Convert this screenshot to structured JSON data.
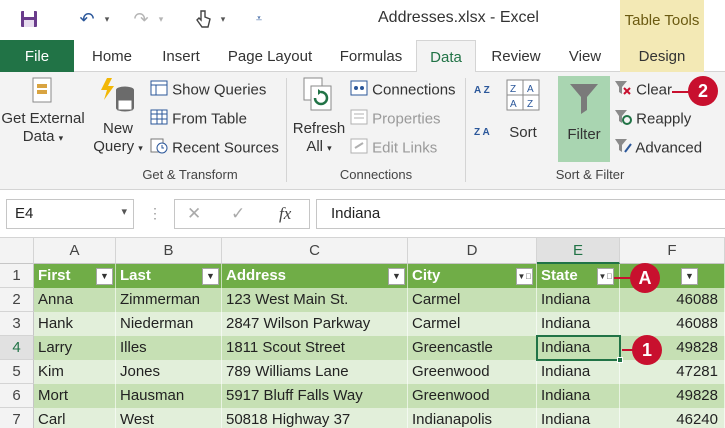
{
  "title_bar": {
    "title": "Addresses.xlsx - Excel",
    "table_tools": "Table Tools"
  },
  "tabs": [
    {
      "label": "File"
    },
    {
      "label": "Home"
    },
    {
      "label": "Insert"
    },
    {
      "label": "Page Layout"
    },
    {
      "label": "Formulas"
    },
    {
      "label": "Data"
    },
    {
      "label": "Review"
    },
    {
      "label": "View"
    },
    {
      "label": "Design"
    }
  ],
  "ribbon": {
    "get_external_1": "Get External",
    "get_external_2": "Data",
    "new_query_1": "New",
    "new_query_2": "Query",
    "show_queries": "Show Queries",
    "from_table": "From Table",
    "recent_sources": "Recent Sources",
    "group_get_transform": "Get & Transform",
    "refresh_1": "Refresh",
    "refresh_2": "All",
    "connections": "Connections",
    "properties": "Properties",
    "edit_links": "Edit Links",
    "group_connections": "Connections",
    "sort": "Sort",
    "filter": "Filter",
    "clear": "Clear",
    "reapply": "Reapply",
    "advanced": "Advanced",
    "group_sort_filter": "Sort & Filter",
    "az": "A Z",
    "za": "Z A"
  },
  "formula_bar": {
    "name_box": "E4",
    "fx": "fx",
    "value": "Indiana"
  },
  "columns": [
    "A",
    "B",
    "C",
    "D",
    "E",
    "F"
  ],
  "rows": [
    "1",
    "2",
    "3",
    "4",
    "5",
    "6",
    "7"
  ],
  "table_headers": [
    "First",
    "Last",
    "Address",
    "City",
    "State",
    ""
  ],
  "table_rows": [
    [
      "Anna",
      "Zimmerman",
      "123 West Main St.",
      "Carmel",
      "Indiana",
      "46088"
    ],
    [
      "Hank",
      "Niederman",
      "2847 Wilson Parkway",
      "Carmel",
      "Indiana",
      "46088"
    ],
    [
      "Larry",
      "Illes",
      "1811 Scout Street",
      "Greencastle",
      "Indiana",
      "49828"
    ],
    [
      "Kim",
      "Jones",
      "789 Williams Lane",
      "Greenwood",
      "Indiana",
      "47281"
    ],
    [
      "Mort",
      "Hausman",
      "5917 Bluff Falls Way",
      "Greenwood",
      "Indiana",
      "49828"
    ],
    [
      "Carl",
      "West",
      "50818 Highway 37",
      "Indianapolis",
      "Indiana",
      "46240"
    ]
  ],
  "callouts": {
    "one": "1",
    "two": "2",
    "a": "A"
  },
  "colors": {
    "excel_green": "#217346",
    "table_header": "#70ad47",
    "band_dark": "#c6e0b4",
    "band_light": "#e2efda",
    "callout_red": "#c8102e"
  }
}
